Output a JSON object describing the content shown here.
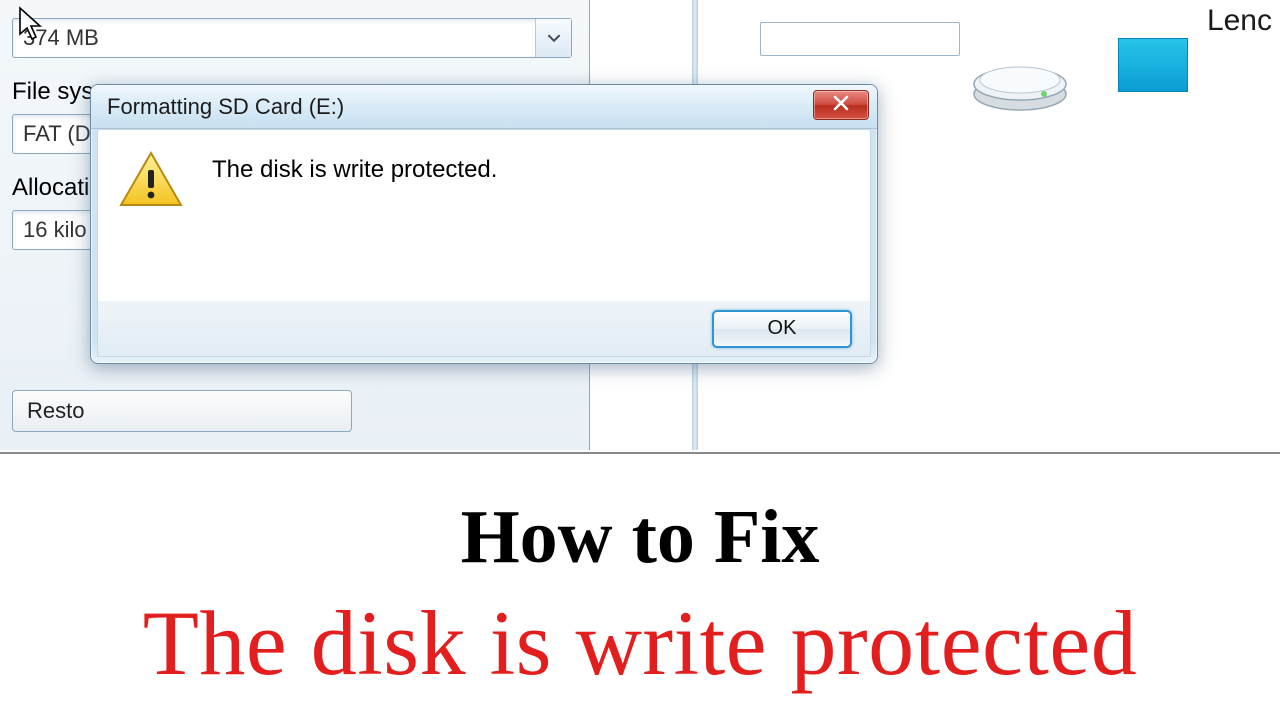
{
  "format_dialog": {
    "capacity_value": "374 MB",
    "filesystem_label": "File sys",
    "filesystem_value": "FAT (D",
    "allocation_label": "Allocati",
    "allocation_value": "16 kilo",
    "restore_button": "Resto"
  },
  "explorer": {
    "label_partial": "Lenc"
  },
  "error_dialog": {
    "title": "Formatting SD Card (E:)",
    "message": "The disk is write protected.",
    "ok_label": "OK"
  },
  "caption": {
    "line1": "How to Fix",
    "line2": "The disk is write protected"
  }
}
